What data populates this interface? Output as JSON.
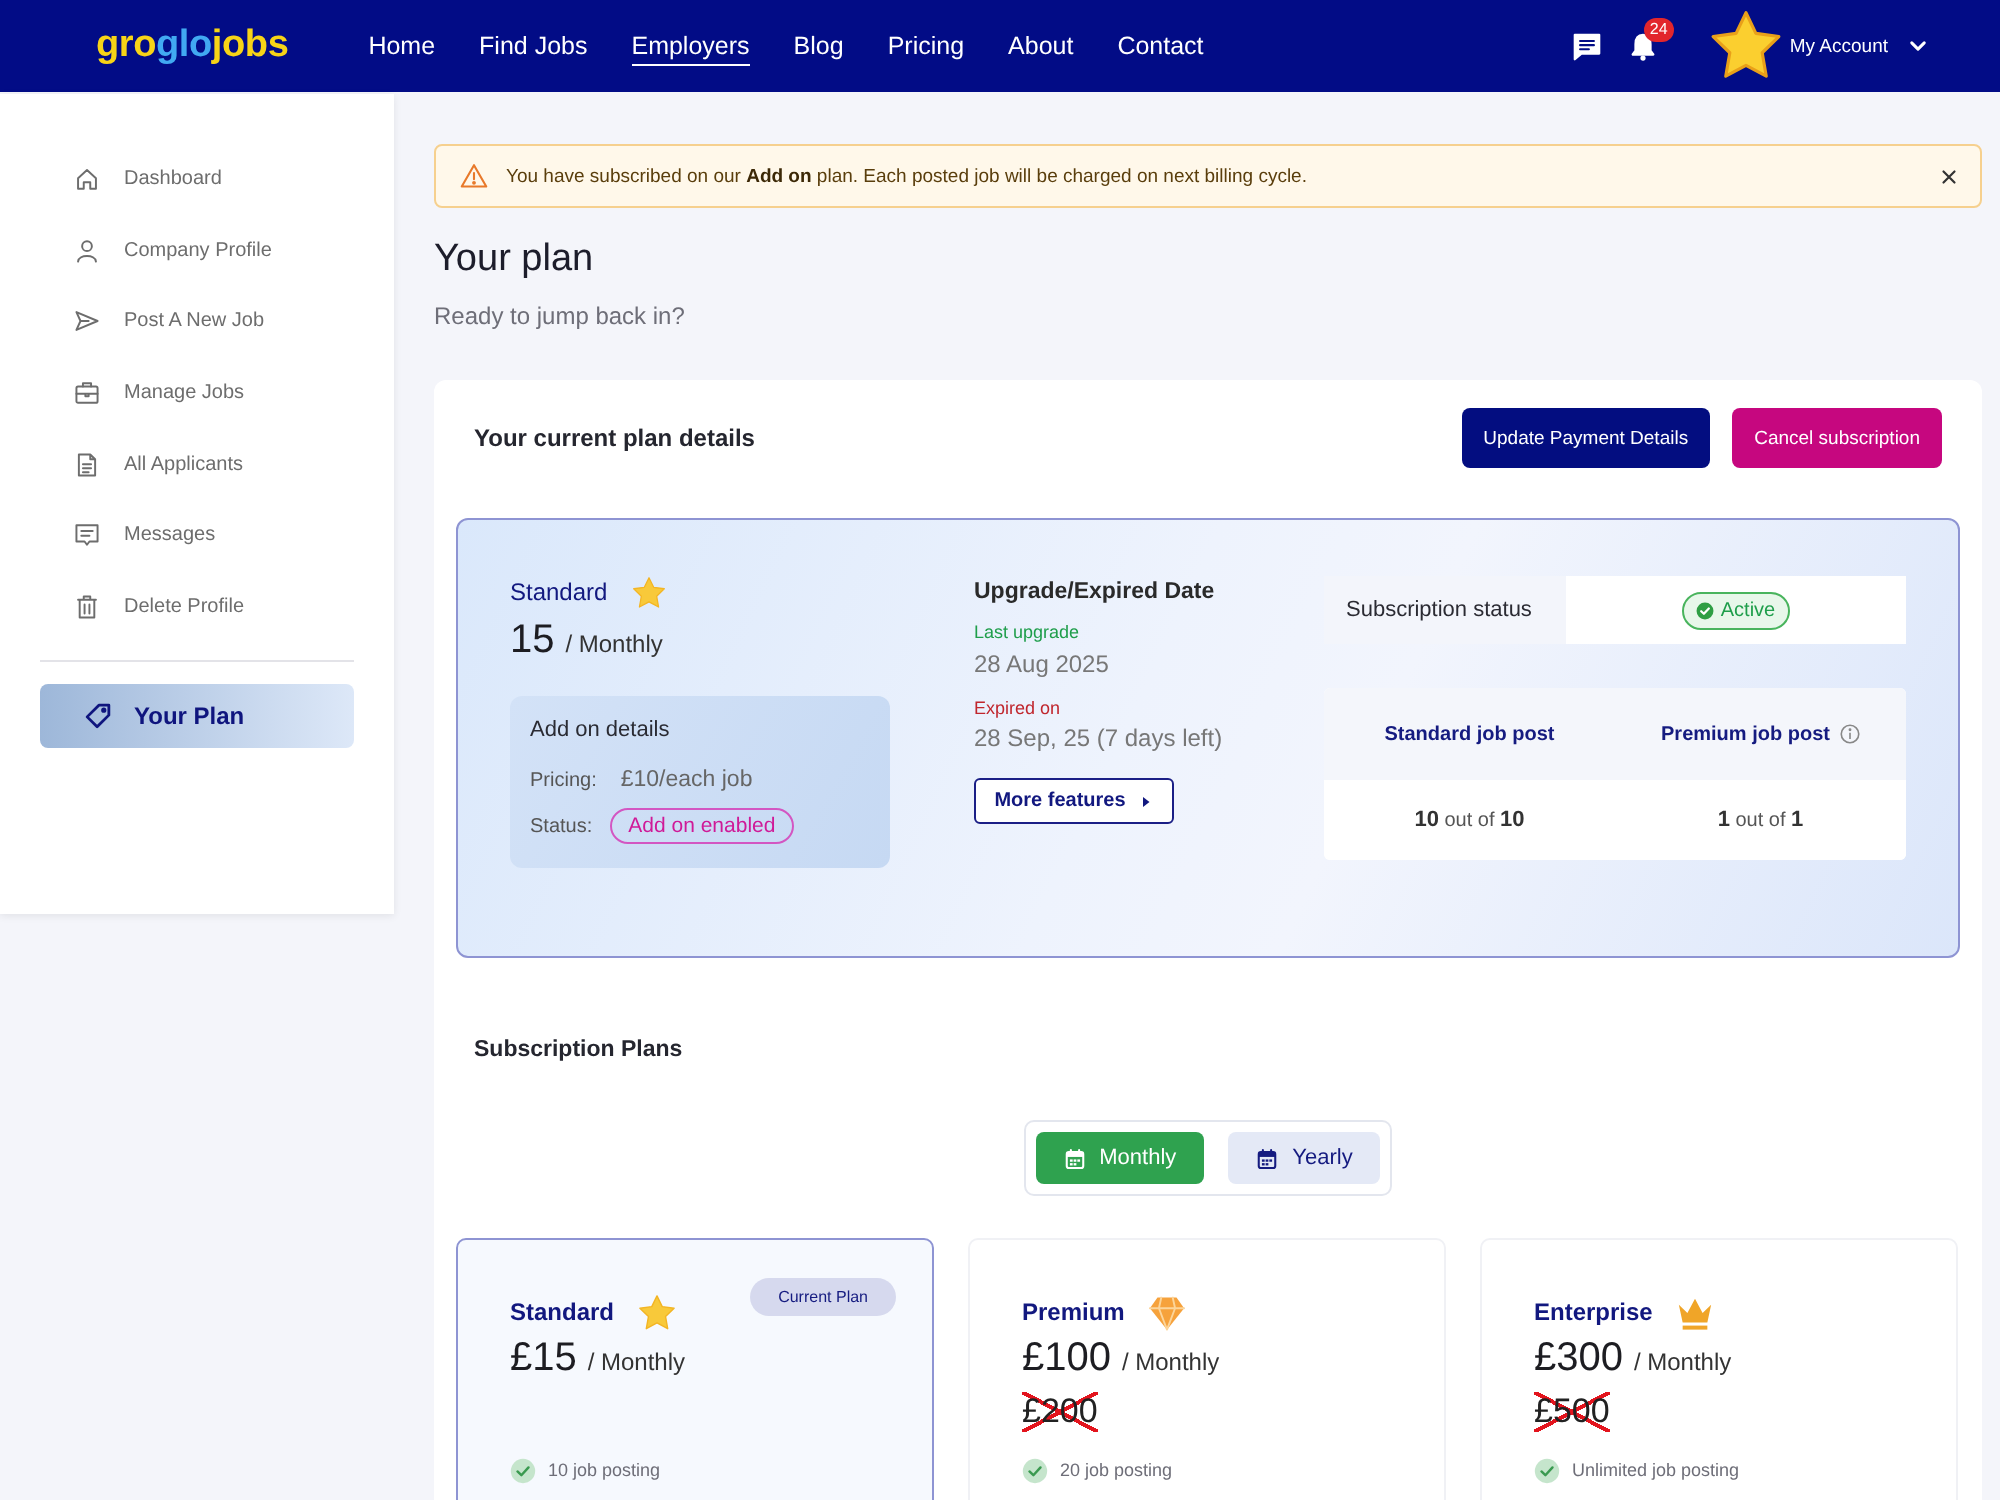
{
  "navbar": {
    "logo": [
      {
        "text": "gro",
        "color": "#f7d417"
      },
      {
        "text": "glo",
        "color": "#41a9f2"
      },
      {
        "text": "jobs",
        "color": "#f7d417"
      }
    ],
    "links": [
      {
        "label": "Home",
        "selected": false
      },
      {
        "label": "Find Jobs",
        "selected": false
      },
      {
        "label": "Employers",
        "selected": true
      },
      {
        "label": "Blog",
        "selected": false
      },
      {
        "label": "Pricing",
        "selected": false
      },
      {
        "label": "About",
        "selected": false
      },
      {
        "label": "Contact",
        "selected": false
      }
    ],
    "notification_count": "24",
    "account_label": "My Account"
  },
  "sidebar": {
    "items": [
      {
        "label": "Dashboard",
        "selected": false
      },
      {
        "label": "Company Profile",
        "selected": false
      },
      {
        "label": "Post A New Job",
        "selected": false
      },
      {
        "label": "Manage Jobs",
        "selected": false
      },
      {
        "label": "All Applicants",
        "selected": false
      },
      {
        "label": "Messages",
        "selected": false
      },
      {
        "label": "Delete Profile",
        "selected": false
      }
    ],
    "footer_items": [
      {
        "label": "Your Plan",
        "selected": true
      }
    ]
  },
  "alert": {
    "text": "You have subscribed on our **Add on** plan. Each posted job will be charged on next billing cycle."
  },
  "page": {
    "title": "Your plan",
    "subtitle": "Ready to jump back in?"
  },
  "current_plan": {
    "heading": "Your current plan details",
    "buttons": [
      {
        "label": "Update Payment Details",
        "kind": "primary"
      },
      {
        "label": "Cancel subscription",
        "kind": "danger"
      }
    ],
    "plan": {
      "name": "Standard",
      "price": "15",
      "period": "/ Monthly"
    },
    "addon": {
      "title": "Add on details",
      "pricing_label": "Pricing:",
      "pricing_value": "£10/each job",
      "status_label": "Status:",
      "status_value": "Add on enabled"
    },
    "dates": {
      "title": "Upgrade/Expired Date",
      "last_upgrade_label": "Last upgrade",
      "last_upgrade": "28 Aug 2025",
      "expiry_label": "Expired on",
      "expiry": "28 Sep, 25 (7 days left)",
      "more_button": "More features"
    },
    "status": {
      "label": "Subscription status",
      "value": "Active"
    },
    "usage": {
      "columns": [
        {
          "label": "Standard job post",
          "info": false
        },
        {
          "label": "Premium job post",
          "info": true
        }
      ],
      "values": [
        "**10** out of **10**",
        "**1** out of **1**"
      ]
    }
  },
  "subscription_plans": {
    "heading": "Subscription Plans",
    "billing_toggle": [
      {
        "label": "Monthly",
        "selected": true
      },
      {
        "label": "Yearly",
        "selected": false
      }
    ],
    "plans": [
      {
        "name": "Standard",
        "badge": "Current Plan",
        "price": "£15",
        "period": "/ Monthly",
        "features": [
          "10 job posting"
        ],
        "selected": true
      },
      {
        "name": "Premium",
        "price": "£100",
        "period": "/ Monthly",
        "old_price": "£200",
        "features": [
          "20 job posting"
        ],
        "selected": false
      },
      {
        "name": "Enterprise",
        "price": "£300",
        "period": "/ Monthly",
        "old_price": "£500",
        "features": [
          "Unlimited job posting"
        ],
        "selected": false
      }
    ]
  }
}
